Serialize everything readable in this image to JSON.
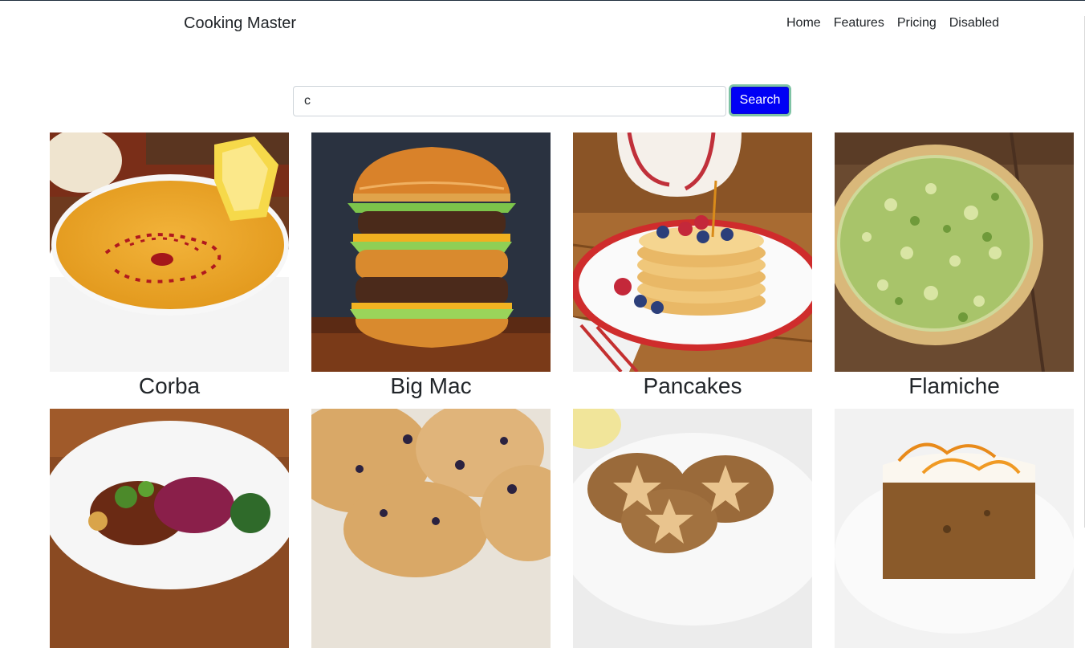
{
  "navbar": {
    "brand": "Cooking Master",
    "links": [
      "Home",
      "Features",
      "Pricing",
      "Disabled"
    ]
  },
  "search": {
    "value": "c",
    "button_label": "Search"
  },
  "meals": [
    {
      "title": "Corba",
      "image": "orange lentil soup in white bowl with lemon slice"
    },
    {
      "title": "Big Mac",
      "image": "double cheeseburger"
    },
    {
      "title": "Pancakes",
      "image": "pancake stack with berries and syrup"
    },
    {
      "title": "Flamiche",
      "image": "leek tart"
    },
    {
      "title": "",
      "image": "stew with greens on white plate"
    },
    {
      "title": "",
      "image": "blueberry scones"
    },
    {
      "title": "",
      "image": "mince pies with star tops"
    },
    {
      "title": "",
      "image": "carrot cake slice with orange zest"
    }
  ],
  "colors": {
    "search_button": "#0000f5",
    "search_button_border": "#7fc3a5"
  }
}
